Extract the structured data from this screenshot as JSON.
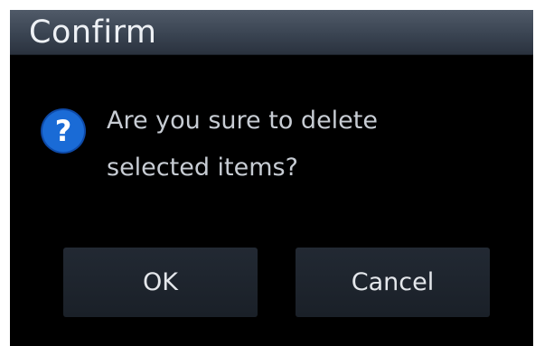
{
  "dialog": {
    "title": "Confirm",
    "icon": "question-icon",
    "message_line1": "Are you sure to delete",
    "message_line2": "selected items?",
    "ok_label": "OK",
    "cancel_label": "Cancel"
  },
  "colors": {
    "background": "#000000",
    "titlebar": "#3a4452",
    "icon_blue": "#1a6bd6",
    "button": "#1e242d",
    "text": "#c7ccd3"
  }
}
